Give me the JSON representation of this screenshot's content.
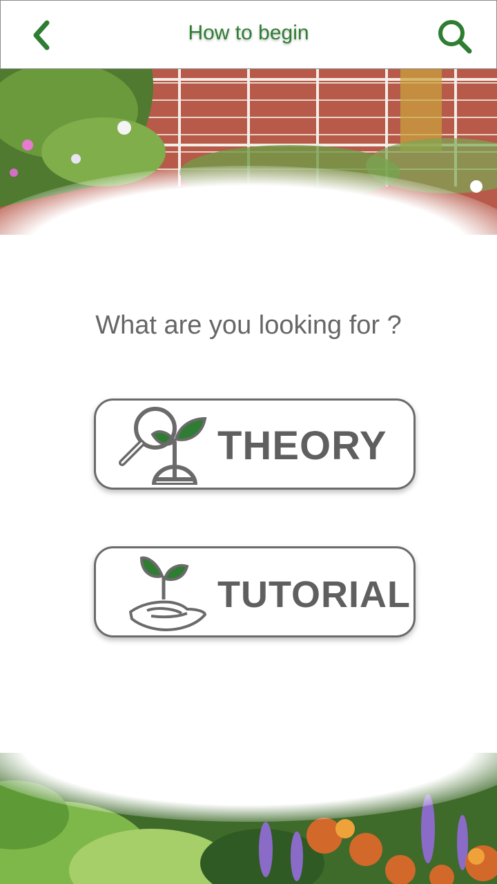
{
  "header": {
    "title": "How to begin",
    "back_icon": "chevron-left-icon",
    "search_icon": "search-icon",
    "accent_color": "#2e7d32"
  },
  "main": {
    "question": "What are you looking for ?",
    "options": [
      {
        "label": "THEORY",
        "icon": "magnifier-sprout-icon"
      },
      {
        "label": "TUTORIAL",
        "icon": "hand-sprout-icon"
      }
    ]
  }
}
